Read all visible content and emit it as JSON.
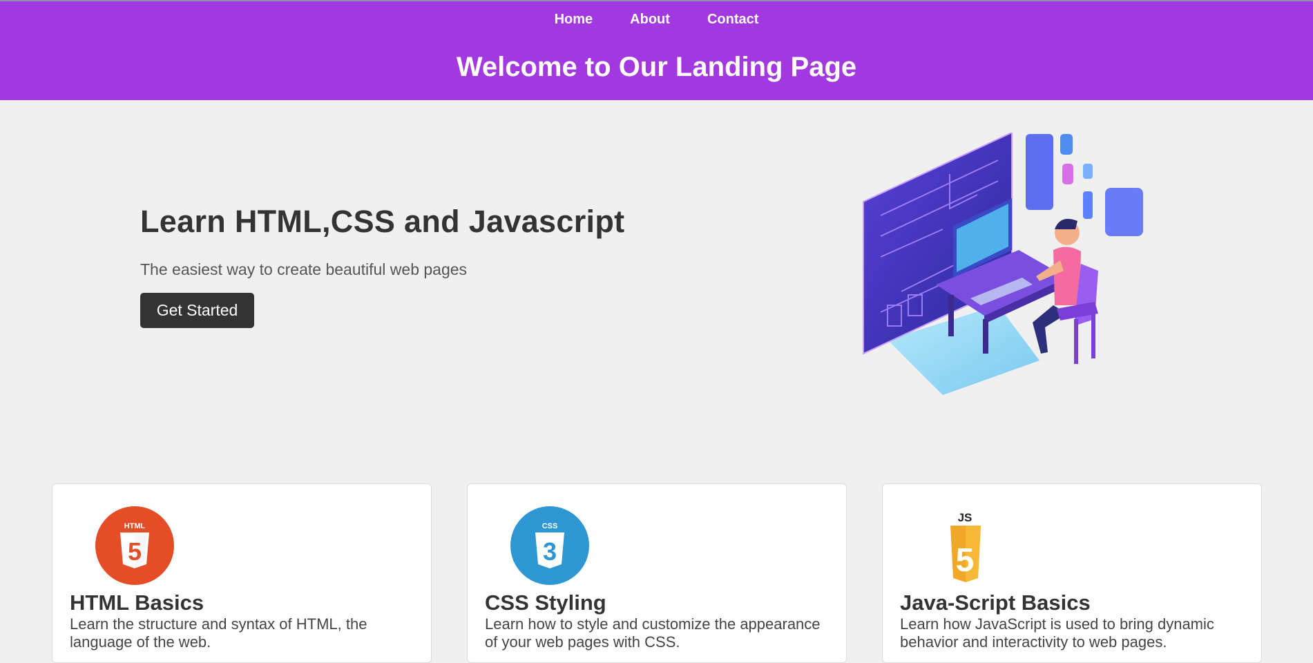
{
  "nav": {
    "items": [
      {
        "label": "Home"
      },
      {
        "label": "About"
      },
      {
        "label": "Contact"
      }
    ]
  },
  "header": {
    "title": "Welcome to Our Landing Page"
  },
  "hero": {
    "heading": "Learn HTML,CSS and Javascript",
    "subtitle": "The easiest way to create beautiful web pages",
    "cta_label": "Get Started"
  },
  "cards": [
    {
      "icon": "html5-logo-icon",
      "logo_text": "HTML",
      "title": "HTML Basics",
      "desc": "Learn the structure and syntax of HTML, the language of the web."
    },
    {
      "icon": "css3-logo-icon",
      "logo_text": "CSS",
      "title": "CSS Styling",
      "desc": "Learn how to style and customize the appearance of your web pages with CSS."
    },
    {
      "icon": "javascript-logo-icon",
      "logo_text": "JS",
      "title": "Java-Script Basics",
      "desc": "Learn how JavaScript is used to bring dynamic behavior and interactivity to web pages."
    }
  ],
  "colors": {
    "header_bg": "#a238e0",
    "page_bg": "#f0f0f0",
    "button_bg": "#333333",
    "html_orange": "#e44d26",
    "css_blue": "#2f96d4",
    "js_yellow": "#f0a828"
  }
}
